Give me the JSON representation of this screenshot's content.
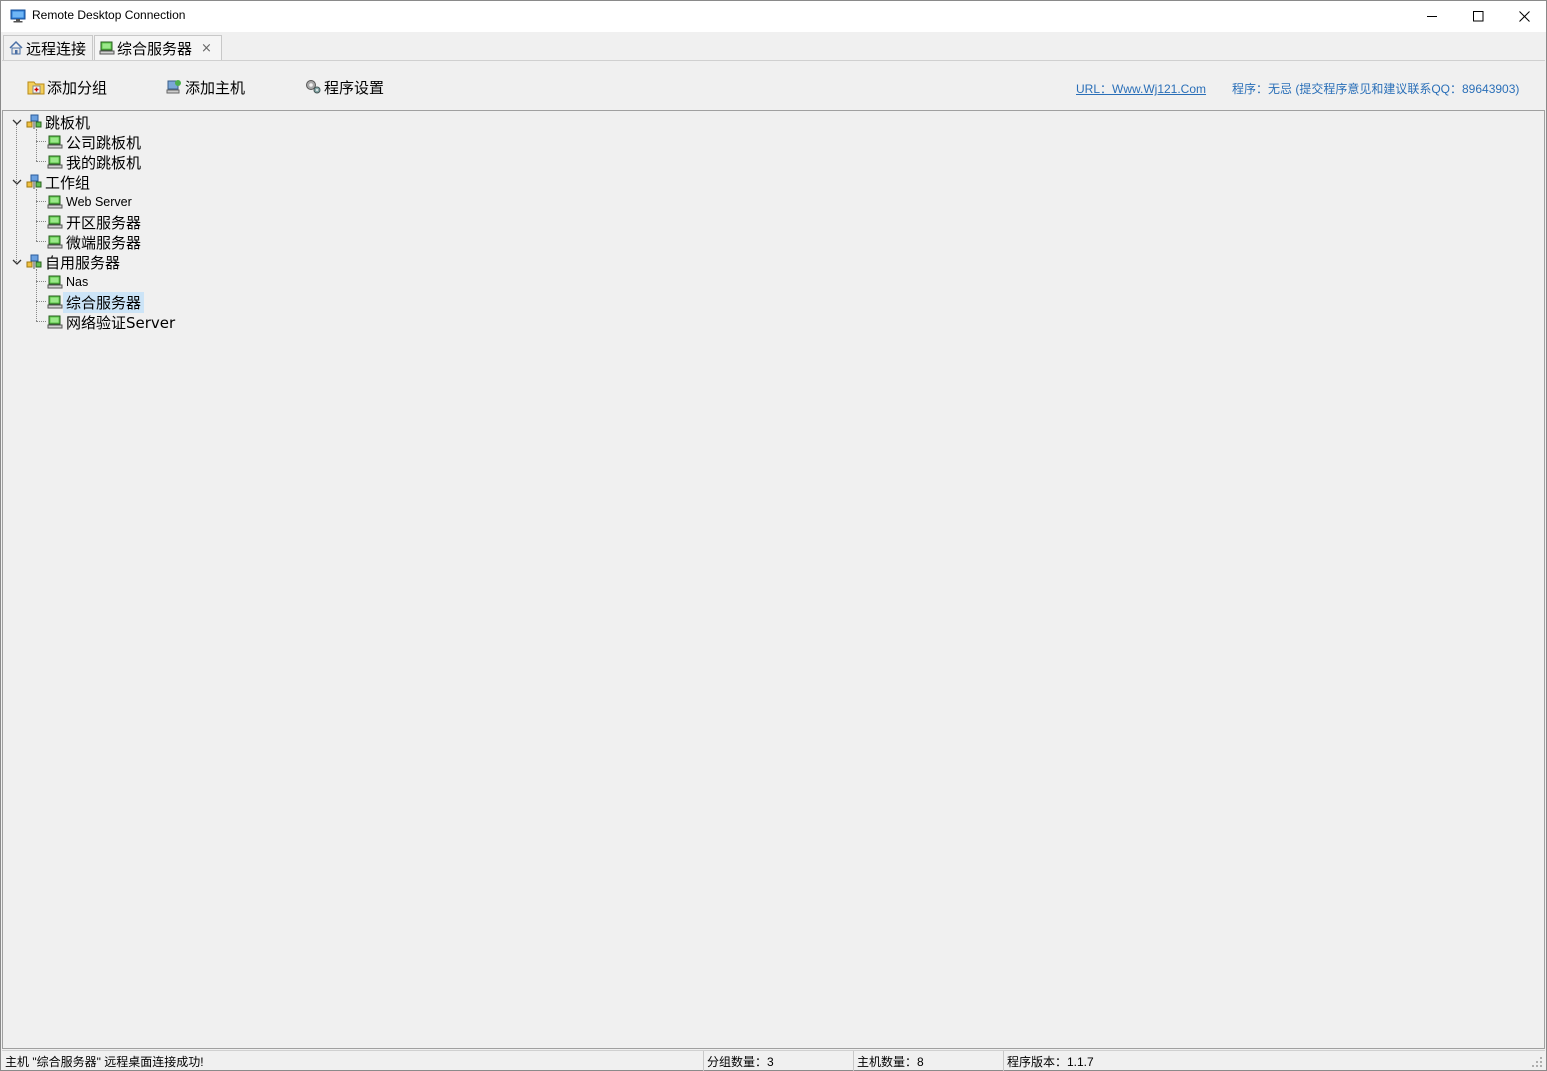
{
  "window": {
    "title": "Remote Desktop Connection"
  },
  "tabs": [
    {
      "label": "远程连接",
      "icon": "home-icon"
    },
    {
      "label": "综合服务器",
      "icon": "computer-icon",
      "close": "×"
    }
  ],
  "toolbar": {
    "add_group": "添加分组",
    "add_host": "添加主机",
    "settings": "程序设置",
    "url": "URL：Www.Wj121.Com",
    "program_info": "程序：无忌 (提交程序意见和建议联系QQ：89643903)"
  },
  "tree": {
    "groups": [
      {
        "label": "跳板机",
        "hosts": [
          "公司跳板机",
          "我的跳板机"
        ]
      },
      {
        "label": "工作组",
        "hosts": [
          "Web Server",
          "开区服务器",
          "微端服务器"
        ]
      },
      {
        "label": "自用服务器",
        "hosts": [
          "Nas",
          "综合服务器",
          "网络验证Server"
        ]
      }
    ],
    "selected": "综合服务器"
  },
  "status": {
    "message": "主机 \"综合服务器\" 远程桌面连接成功!",
    "groups": "分组数量：3",
    "hosts": "主机数量：8",
    "version": "程序版本：1.1.7"
  },
  "colors": {
    "accent_link": "#2a6fb8",
    "selection": "#cce4f7",
    "background": "#f0f0f0"
  }
}
